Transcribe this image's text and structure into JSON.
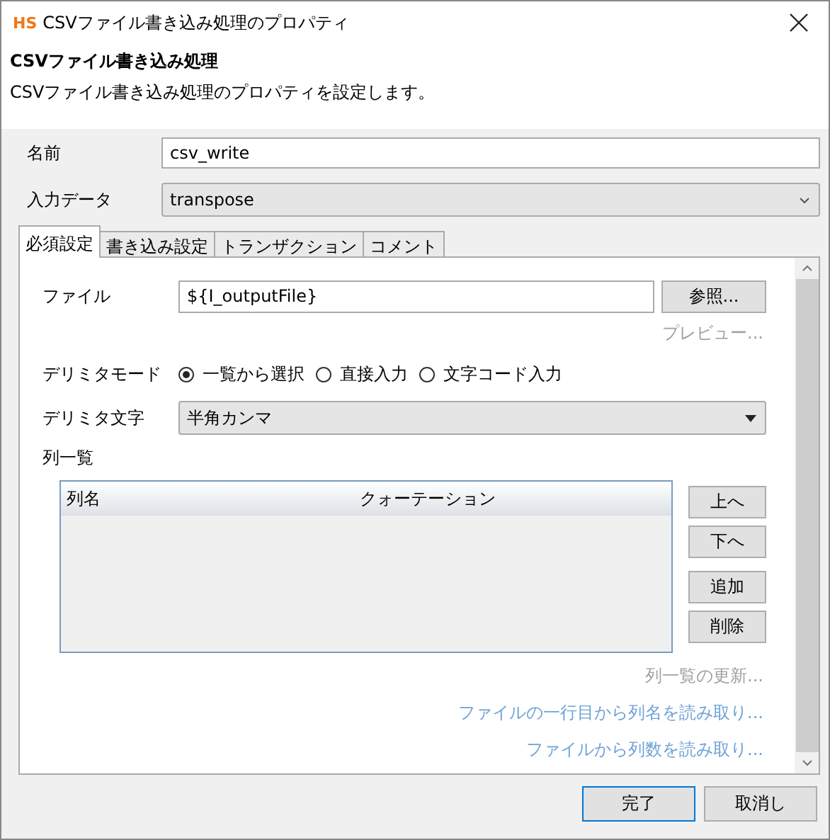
{
  "window": {
    "logo": "HS",
    "title": "CSVファイル書き込み処理のプロパティ"
  },
  "header": {
    "title": "CSVファイル書き込み処理",
    "description": "CSVファイル書き込み処理のプロパティを設定します。"
  },
  "name_field": {
    "label": "名前",
    "value": "csv_write"
  },
  "input_data": {
    "label": "入力データ",
    "value": "transpose"
  },
  "tabs": [
    {
      "label": "必須設定",
      "selected": true
    },
    {
      "label": "書き込み設定",
      "selected": false
    },
    {
      "label": "トランザクション",
      "selected": false
    },
    {
      "label": "コメント",
      "selected": false
    }
  ],
  "file": {
    "label": "ファイル",
    "value": "${I_outputFile}",
    "button": "参照..."
  },
  "preview_link": {
    "label": "プレビュー...",
    "disabled": true
  },
  "delimiter_mode": {
    "label": "デリミタモード",
    "options": [
      {
        "label": "一覧から選択",
        "selected": true
      },
      {
        "label": "直接入力",
        "selected": false
      },
      {
        "label": "文字コード入力",
        "selected": false
      }
    ]
  },
  "delimiter_char": {
    "label": "デリミタ文字",
    "value": "半角カンマ"
  },
  "column_list": {
    "label": "列一覧",
    "columns": [
      "列名",
      "クォーテーション"
    ],
    "buttons": [
      "上へ",
      "下へ",
      "追加",
      "削除"
    ]
  },
  "links": [
    {
      "label": "列一覧の更新...",
      "disabled": true
    },
    {
      "label": "ファイルの一行目から列名を読み取り...",
      "disabled": false
    },
    {
      "label": "ファイルから列数を読み取り...",
      "disabled": false
    }
  ],
  "buttons": [
    {
      "label": "完了",
      "default": true
    },
    {
      "label": "取消し",
      "default": false
    }
  ]
}
